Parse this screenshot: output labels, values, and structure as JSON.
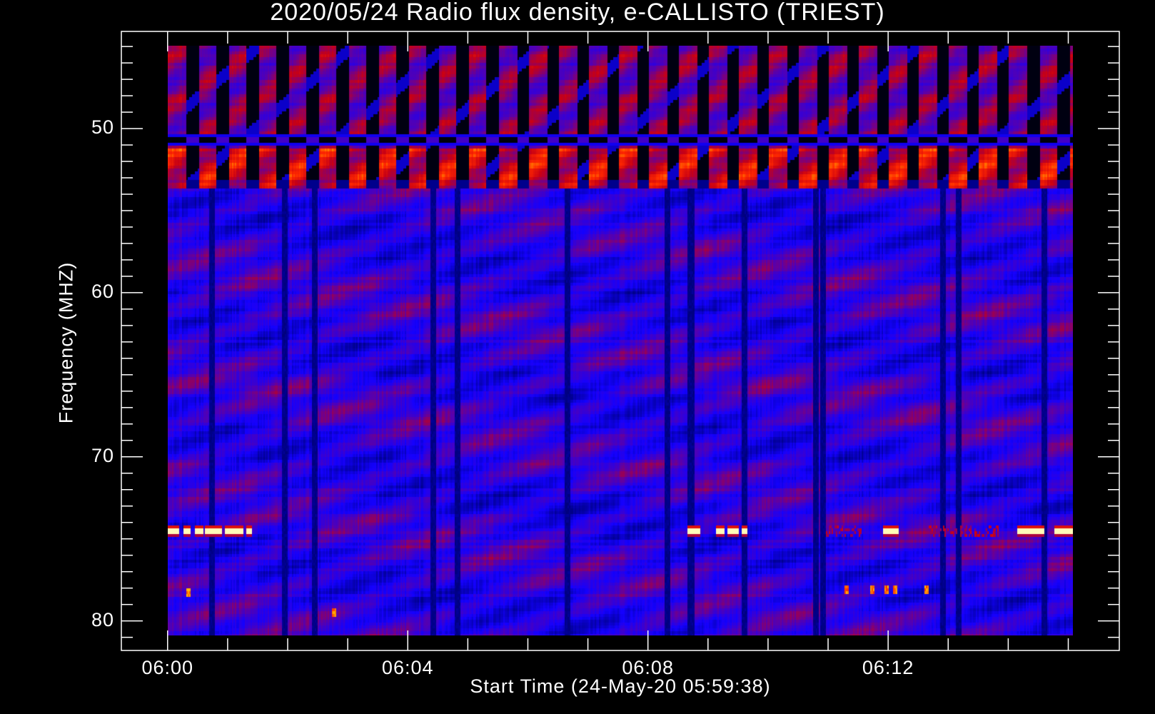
{
  "chart_data": {
    "type": "heatmap",
    "title": "2020/05/24  Radio flux density, e-CALLISTO (TRIEST)",
    "xlabel": "Start Time (24-May-20 05:59:38)",
    "ylabel": "Frequency (MHZ)",
    "x_unit": "minutes after 06:00 UT",
    "x_range": [
      -0.77,
      15.85
    ],
    "x_data_range": [
      0,
      15.07
    ],
    "x_major_ticks": [
      {
        "value": 0,
        "label": "06:00"
      },
      {
        "value": 4,
        "label": "06:04"
      },
      {
        "value": 8,
        "label": "06:08"
      },
      {
        "value": 12,
        "label": "06:12"
      }
    ],
    "x_minor_step": 1,
    "y_range": [
      44.08,
      81.8
    ],
    "y_data_range": [
      44.95,
      80.9
    ],
    "y_inverted": true,
    "y_major_ticks": [
      {
        "value": 50,
        "label": "50"
      },
      {
        "value": 60,
        "label": "60"
      },
      {
        "value": 70,
        "label": "70"
      },
      {
        "value": 80,
        "label": "80"
      }
    ],
    "y_minor_step": 1,
    "colormap": [
      "#000000",
      "#00008c",
      "#1400ff",
      "#5a00aa",
      "#c80014",
      "#ff2800",
      "#ffe600",
      "#ffffe6"
    ],
    "features": {
      "gated_band_mhz": [
        44.95,
        53.5
      ],
      "gated_period_min": 0.5,
      "gap_band_mhz": [
        50.3,
        51.0
      ],
      "dark_stripes_min": [
        0.72,
        1.93,
        2.44,
        4.4,
        4.81,
        6.64,
        8.31,
        8.7,
        9.6,
        10.78,
        10.89,
        12.9,
        13.15,
        14.58
      ],
      "interference_freq_mhz": 74.5,
      "interference_bursts_min": [
        [
          0,
          0.17
        ],
        [
          0.25,
          0.37
        ],
        [
          0.43,
          0.58
        ],
        [
          0.61,
          0.88
        ],
        [
          0.94,
          1.25
        ],
        [
          1.3,
          1.39
        ],
        [
          8.65,
          8.86
        ],
        [
          9.11,
          9.25
        ],
        [
          9.3,
          9.5
        ],
        [
          9.55,
          9.63
        ],
        [
          11.89,
          12.17
        ],
        [
          14.13,
          14.58
        ],
        [
          14.76,
          15.05
        ]
      ],
      "weak_interference_min": [
        [
          10.95,
          11.56
        ],
        [
          12.66,
          13.83
        ]
      ],
      "spots": [
        {
          "t": 0.33,
          "f": 78.2
        },
        {
          "t": 2.76,
          "f": 79.4
        },
        {
          "t": 11.3,
          "f": 78.1
        },
        {
          "t": 11.72,
          "f": 78.1
        },
        {
          "t": 11.95,
          "f": 78.1
        },
        {
          "t": 12.1,
          "f": 78.1
        },
        {
          "t": 12.62,
          "f": 78.1
        }
      ]
    }
  }
}
